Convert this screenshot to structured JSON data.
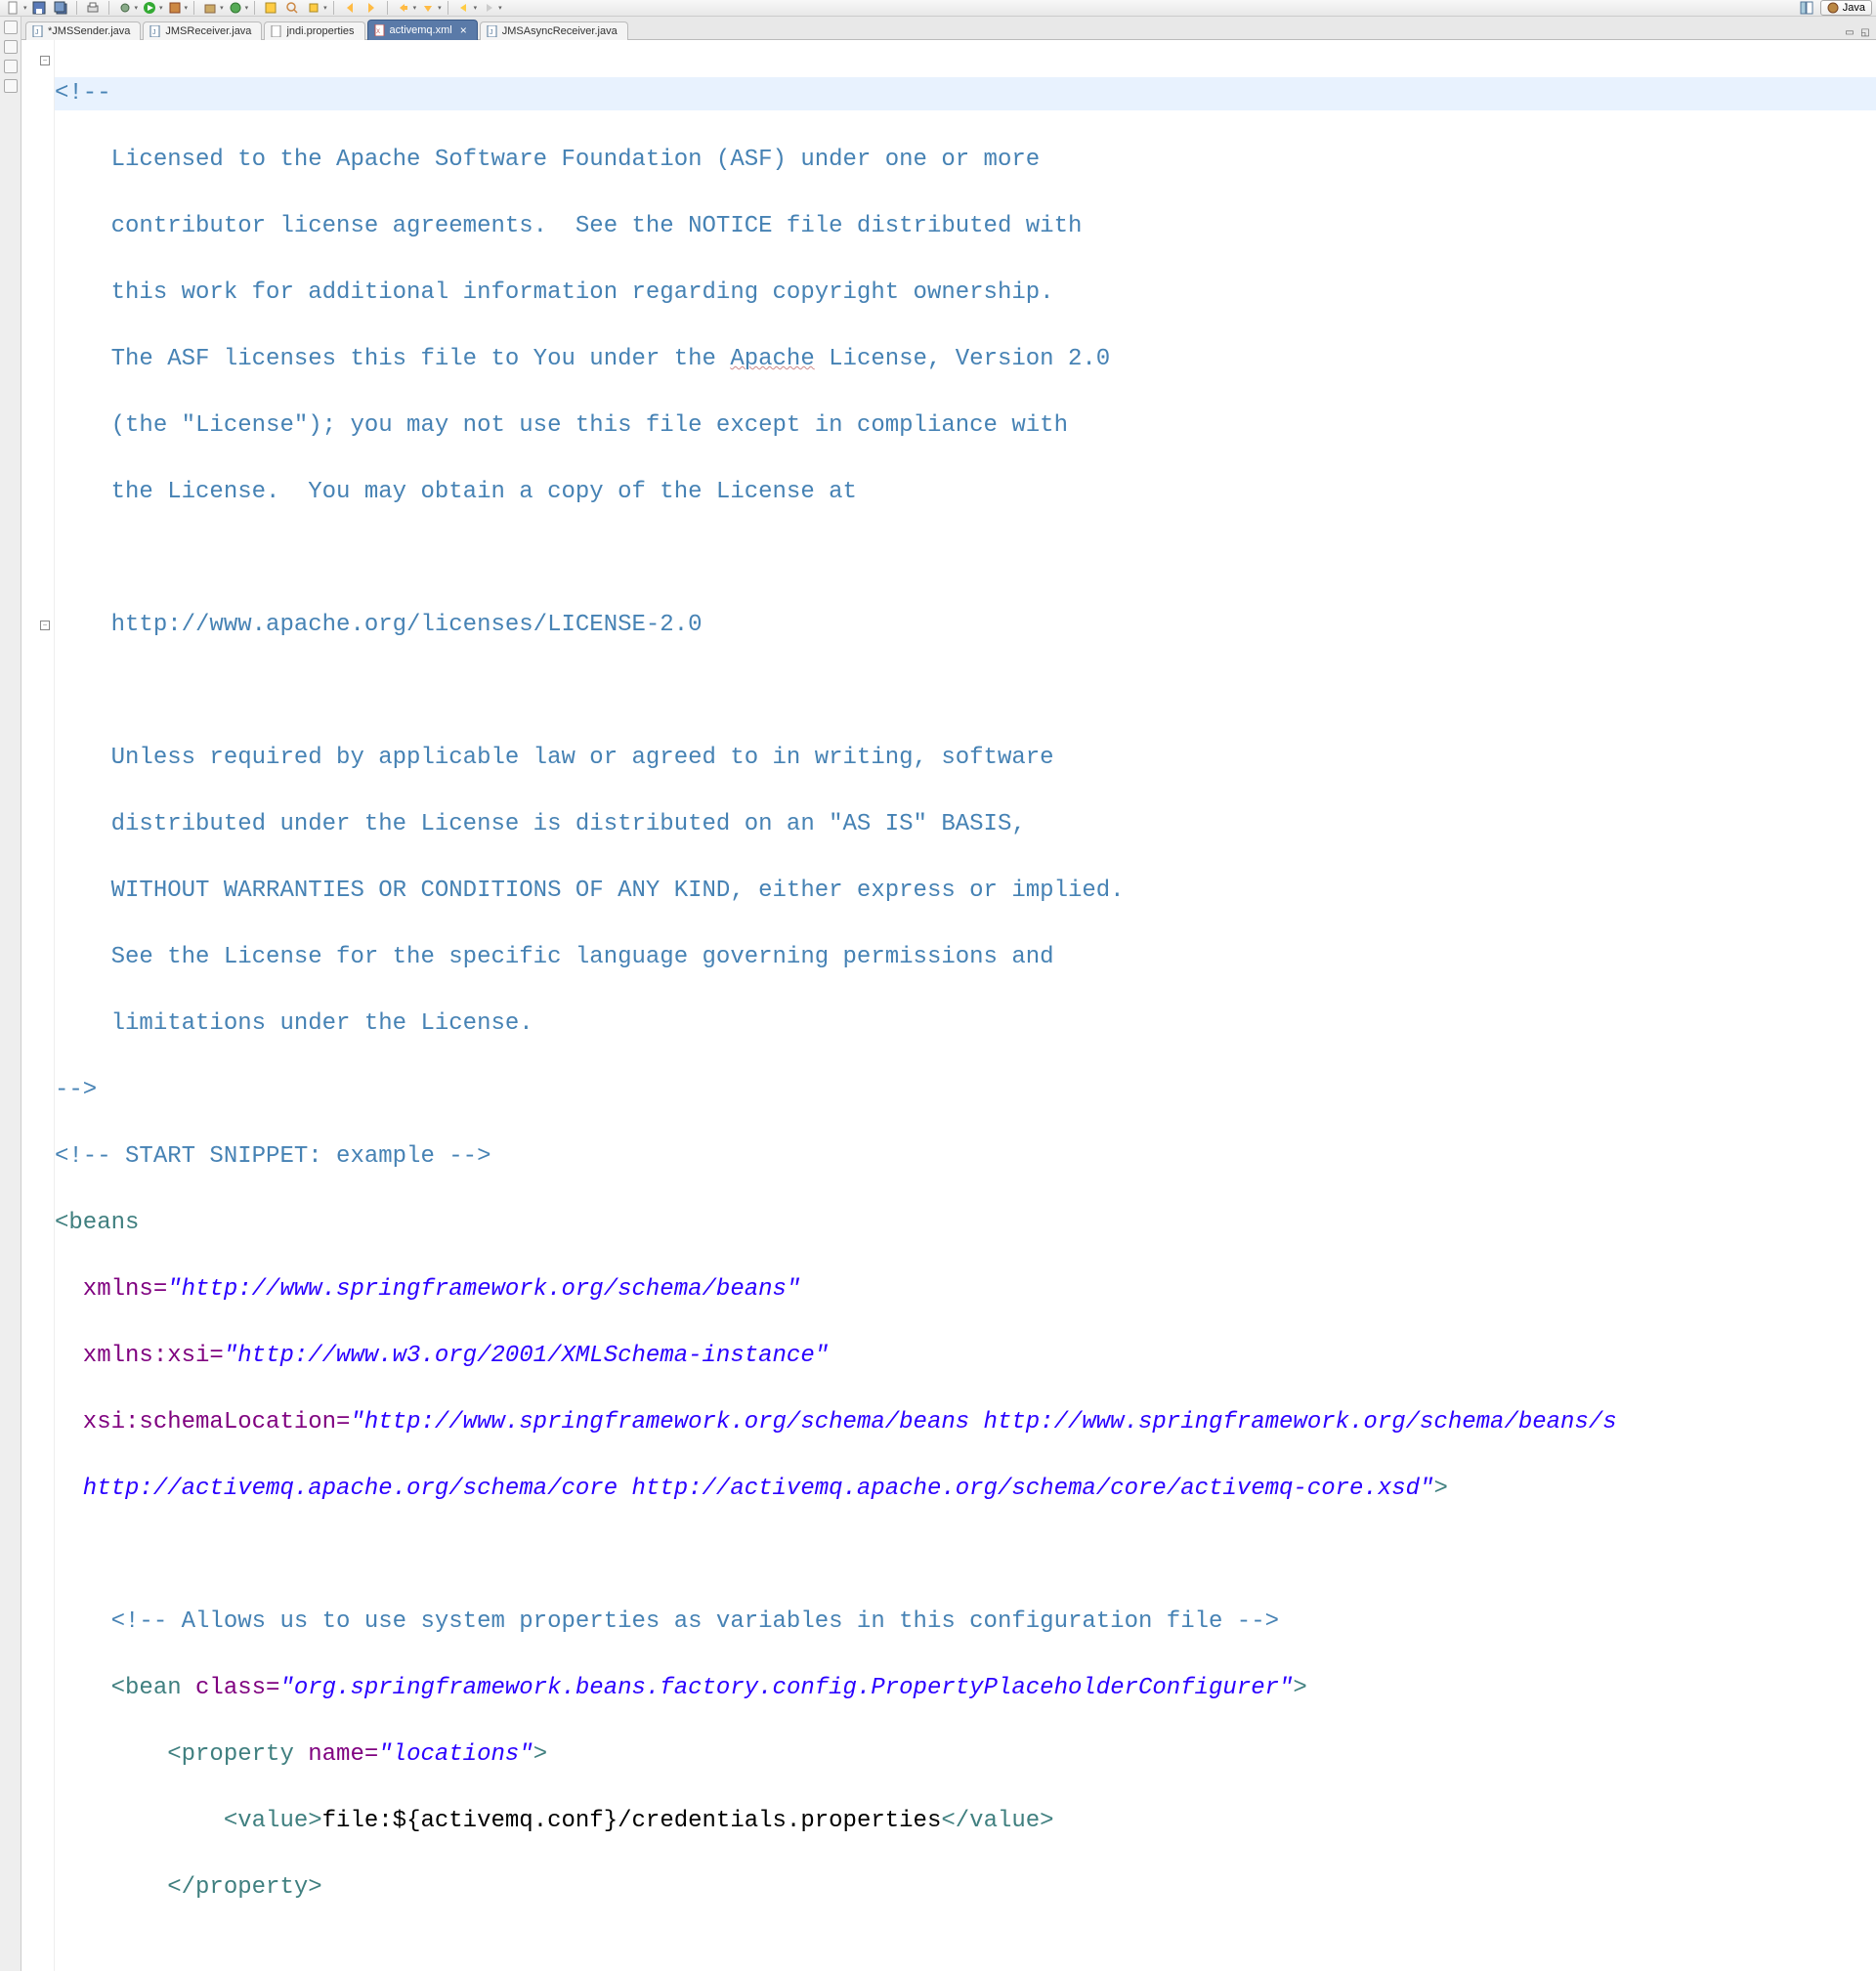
{
  "perspective": {
    "label": "Java"
  },
  "tabs": [
    {
      "label": "*JMSSender.java",
      "icon": "java-file-icon"
    },
    {
      "label": "JMSReceiver.java",
      "icon": "java-file-icon"
    },
    {
      "label": "jndi.properties",
      "icon": "properties-file-icon"
    },
    {
      "label": "activemq.xml",
      "icon": "xml-file-icon",
      "active": true
    },
    {
      "label": "JMSAsyncReceiver.java",
      "icon": "java-file-icon"
    }
  ],
  "code": {
    "l1_a": "<!--",
    "l2": "    Licensed to the Apache Software Foundation (ASF) under one or more",
    "l3": "    contributor license agreements.  See the NOTICE file distributed with",
    "l4": "    this work for additional information regarding copyright ownership.",
    "l5_a": "    The ASF licenses this file to You under the ",
    "l5_b": "Apache",
    "l5_c": " License, Version 2.0",
    "l6": "    (the \"License\"); you may not use this file except in compliance with",
    "l7": "    the License.  You may obtain a copy of the License at",
    "l8": "",
    "l9": "    http://www.apache.org/licenses/LICENSE-2.0",
    "l10": "",
    "l11": "    Unless required by applicable law or agreed to in writing, software",
    "l12": "    distributed under the License is distributed on an \"AS IS\" BASIS,",
    "l13": "    WITHOUT WARRANTIES OR CONDITIONS OF ANY KIND, either express or implied.",
    "l14": "    See the License for the specific language governing permissions and",
    "l15": "    limitations under the License.",
    "l16": "-->",
    "l17": "<!-- START SNIPPET: example -->",
    "l18_tag": "<beans",
    "l19_attr": "  xmlns=",
    "l19_val": "\"http://www.springframework.org/schema/beans\"",
    "l20_attr": "  xmlns:xsi=",
    "l20_val": "\"http://www.w3.org/2001/XMLSchema-instance\"",
    "l21_attr": "  xsi:schemaLocation=",
    "l21_val": "\"http://www.springframework.org/schema/beans http://www.springframework.org/schema/beans/s",
    "l22_val": "  http://activemq.apache.org/schema/core http://activemq.apache.org/schema/core/activemq-core.xsd\"",
    "l22_close": ">",
    "l23": "",
    "l24": "    <!-- Allows us to use system properties as variables in this configuration file -->",
    "l25_a": "    <bean",
    "l25_b": " class=",
    "l25_c": "\"org.springframework.beans.factory.config.PropertyPlaceholderConfigurer\"",
    "l25_d": ">",
    "l26_a": "        <property",
    "l26_b": " name=",
    "l26_c": "\"locations\"",
    "l26_d": ">",
    "l27_a": "            <value>",
    "l27_b": "file:${activemq.conf}/credentials.properties",
    "l27_c": "</value>",
    "l28": "        </property>"
  }
}
